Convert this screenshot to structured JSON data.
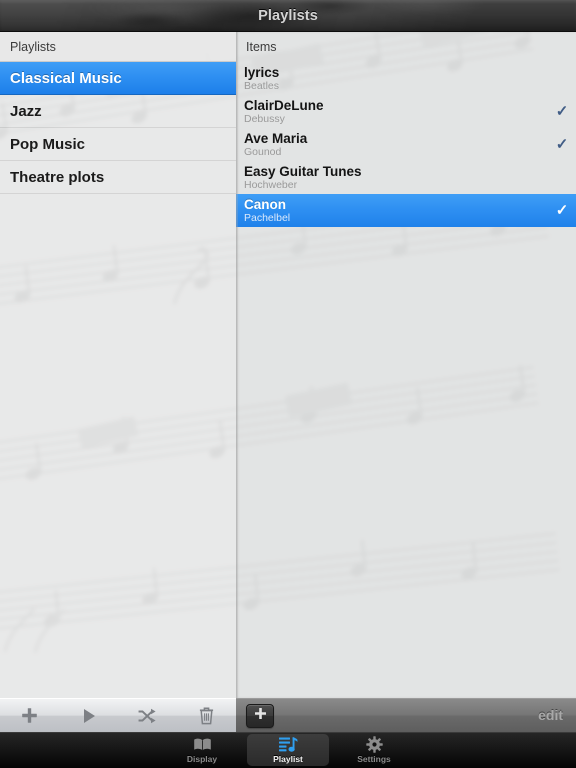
{
  "window": {
    "title": "Playlists"
  },
  "left_pane": {
    "header": "Playlists",
    "items": [
      {
        "label": "Classical Music",
        "selected": true
      },
      {
        "label": "Jazz",
        "selected": false
      },
      {
        "label": "Pop Music",
        "selected": false
      },
      {
        "label": "Theatre plots",
        "selected": false
      }
    ]
  },
  "right_pane": {
    "header": "Items",
    "items": [
      {
        "title": "lyrics",
        "artist": "Beatles",
        "checked": false,
        "selected": false
      },
      {
        "title": "ClairDeLune",
        "artist": "Debussy",
        "checked": true,
        "selected": false
      },
      {
        "title": "Ave Maria",
        "artist": "Gounod",
        "checked": true,
        "selected": false
      },
      {
        "title": "Easy Guitar Tunes",
        "artist": "Hochweber",
        "checked": false,
        "selected": false
      },
      {
        "title": "Canon",
        "artist": "Pachelbel",
        "checked": true,
        "selected": true
      }
    ],
    "check_glyph": "✓"
  },
  "toolbar": {
    "left_buttons": [
      {
        "name": "add-playlist-button",
        "icon": "plus-icon"
      },
      {
        "name": "play-button",
        "icon": "play-icon"
      },
      {
        "name": "shuffle-button",
        "icon": "shuffle-icon"
      },
      {
        "name": "delete-button",
        "icon": "trash-icon"
      }
    ],
    "add_item_icon": "plus-icon",
    "edit_label": "edit"
  },
  "tabbar": {
    "tabs": [
      {
        "label": "Display",
        "icon": "book-icon",
        "active": false
      },
      {
        "label": "Playlist",
        "icon": "playlist-icon",
        "active": true
      },
      {
        "label": "Settings",
        "icon": "gear-icon",
        "active": false
      }
    ]
  },
  "colors": {
    "accent_blue": "#2f90f2",
    "check_blue": "#415d86",
    "titlebar_dark": "#3a3a3a",
    "content_bg": "#e8e9e9",
    "toolbar_right": "#6a6a6a"
  }
}
